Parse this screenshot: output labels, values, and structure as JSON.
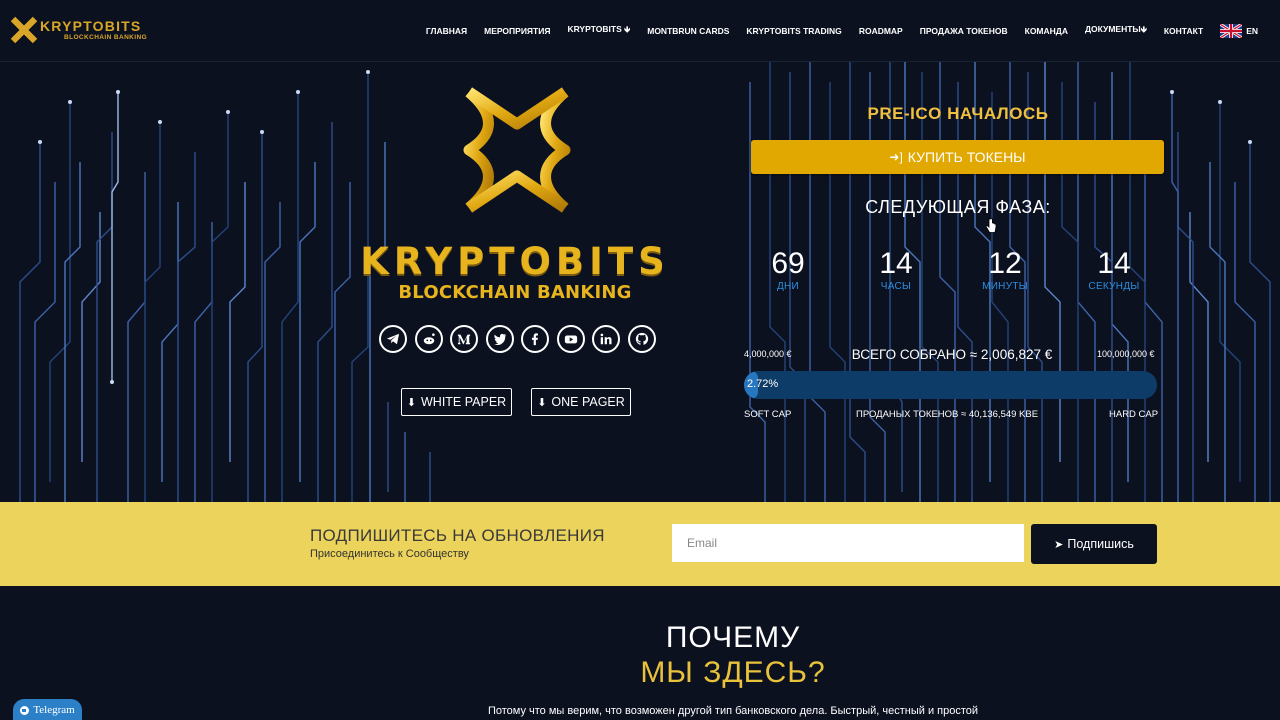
{
  "header": {
    "logo_word": "KRYPTOBITS",
    "logo_sub": "BLOCKCHAIN BANKING",
    "nav": [
      "ГЛАВНАЯ",
      "МЕРОПРИЯТИЯ",
      "KRYPTOBITS 🡻",
      "MONTBRUN CARDS",
      "KRYPTOBITS TRADING",
      "ROADMAP",
      "ПРОДАЖА ТОКЕНОВ",
      "КОМАНДА",
      "ДОКУМЕНТЫ🡻",
      "КОНТАКТ"
    ],
    "lang": "EN"
  },
  "hero": {
    "brand": "KRYPTOBITS",
    "brand_sub": "BLOCKCHAIN BANKING",
    "socials": [
      "telegram-icon",
      "reddit-icon",
      "medium-icon",
      "twitter-icon",
      "facebook-icon",
      "youtube-icon",
      "linkedin-icon",
      "github-icon"
    ],
    "white_paper": "WHITE PAPER",
    "one_pager": "ONE PAGER"
  },
  "sale": {
    "status": "PRE-ICO НАЧАЛОСЬ",
    "buy_label": "КУПИТЬ ТОКЕНЫ",
    "next_phase": "СЛЕДУЮЩАЯ ФАЗА:",
    "countdown": [
      {
        "value": "69",
        "label": "ДНИ"
      },
      {
        "value": "14",
        "label": "ЧАСЫ"
      },
      {
        "value": "12",
        "label": "МИНУТЫ"
      },
      {
        "value": "14",
        "label": "СЕКУНДЫ"
      }
    ],
    "cap_min": "4,000,000 €",
    "cap_max": "100,000,000 €",
    "raised": "ВСЕГО СОБРАНО ≈ 2,006,827 €",
    "progress_label": "2.72%",
    "progress_fraction": 0.0272,
    "soft_cap": "SOFT CAP",
    "hard_cap": "HARD CAP",
    "sold": "ПРОДАНЫХ ТОКЕНОВ ≈ 40,136,549 KBE"
  },
  "subscribe": {
    "title": "ПОДПИШИТЕСЬ НА ОБНОВЛЕНИЯ",
    "desc": "Присоединитесь к Сообществу",
    "email_placeholder": "Email",
    "button": "Подпишись"
  },
  "why": {
    "line1": "ПОЧЕМУ",
    "line2": "МЫ ЗДЕСЬ?",
    "text": "Потому что мы верим, что возможен другой тип банковского дела. Быстрый, честный и простой"
  },
  "telegram_widget": "Telegram",
  "colors": {
    "background": "#0c1120",
    "gold": "#e8b41e",
    "buy_button": "#e0a800",
    "accent_blue": "#2c8fe0",
    "subscribe_band": "#ebd35c"
  }
}
